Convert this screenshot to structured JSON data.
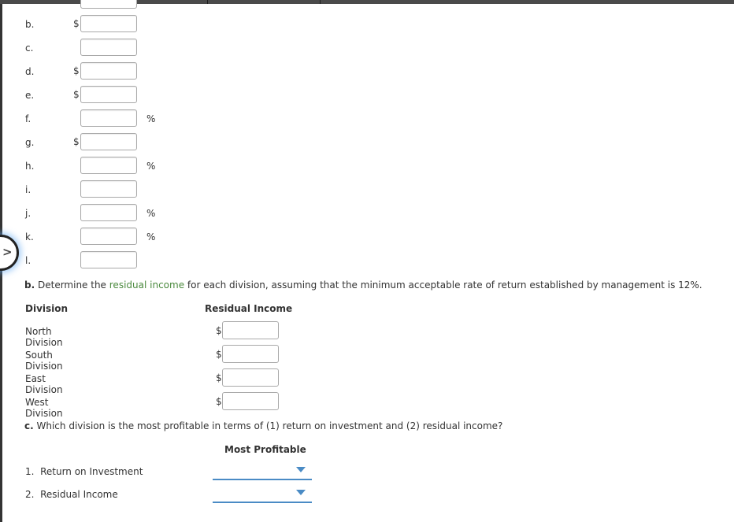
{
  "part_a": {
    "rows": [
      {
        "label": "",
        "prefix": "",
        "suffix": ""
      },
      {
        "label": "b.",
        "prefix": "$",
        "suffix": ""
      },
      {
        "label": "c.",
        "prefix": "",
        "suffix": ""
      },
      {
        "label": "d.",
        "prefix": "$",
        "suffix": ""
      },
      {
        "label": "e.",
        "prefix": "$",
        "suffix": ""
      },
      {
        "label": "f.",
        "prefix": "",
        "suffix": "%"
      },
      {
        "label": "g.",
        "prefix": "$",
        "suffix": ""
      },
      {
        "label": "h.",
        "prefix": "",
        "suffix": "%"
      },
      {
        "label": "i.",
        "prefix": "",
        "suffix": ""
      },
      {
        "label": "j.",
        "prefix": "",
        "suffix": "%"
      },
      {
        "label": "k.",
        "prefix": "",
        "suffix": "%"
      },
      {
        "label": "l.",
        "prefix": "",
        "suffix": ""
      }
    ]
  },
  "part_b": {
    "letter": "b.",
    "text_before": "Determine the",
    "link_text": "residual income",
    "text_after": "for each division, assuming that the minimum acceptable rate of return established by management is 12%.",
    "col_division": "Division",
    "col_residual": "Residual Income",
    "divisions": [
      {
        "name": "North Division",
        "prefix": "$",
        "value": ""
      },
      {
        "name": "South Division",
        "prefix": "$",
        "value": ""
      },
      {
        "name": "East Division",
        "prefix": "$",
        "value": ""
      },
      {
        "name": "West Division",
        "prefix": "$",
        "value": ""
      }
    ]
  },
  "part_c": {
    "letter": "c.",
    "text": "Which division is the most profitable in terms of (1) return on investment and (2) residual income?",
    "col_header": "Most Profitable",
    "items": [
      {
        "label": "1.  Return on Investment",
        "selected": ""
      },
      {
        "label": "2.  Residual Income",
        "selected": ""
      }
    ]
  },
  "collapse_icon": "chevron-right-icon",
  "colors": {
    "link_green": "#4b8a3e",
    "dropdown_blue": "#4a8bc5"
  }
}
